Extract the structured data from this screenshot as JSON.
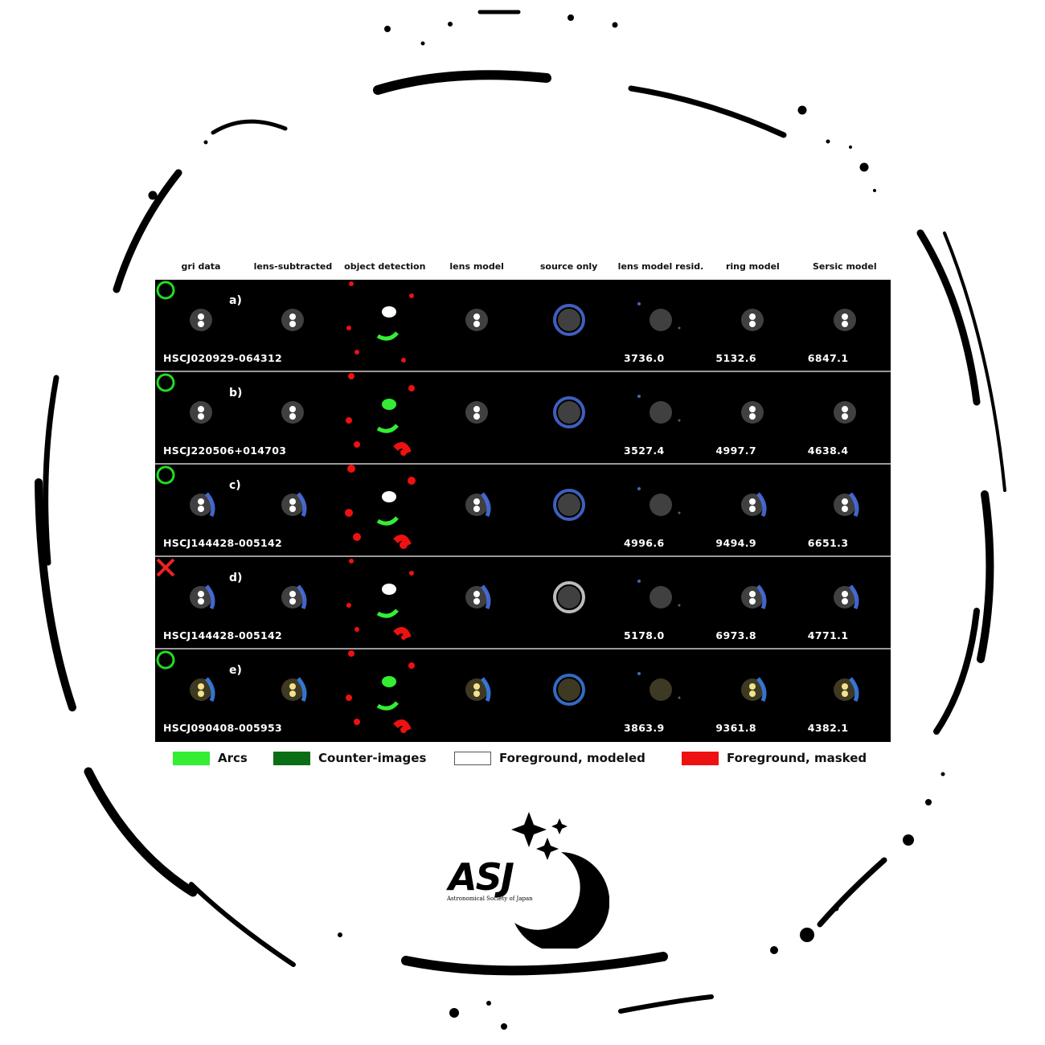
{
  "columns": [
    "gri data",
    "lens-subtracted",
    "object detection",
    "lens model",
    "source only",
    "lens model resid.",
    "ring model",
    "Sersic model"
  ],
  "rows": [
    {
      "label": "a)",
      "id": "HSCJ020929-064312",
      "mark": "circle",
      "scores": [
        "3736.0",
        "5132.6",
        "6847.1"
      ],
      "tint": "blue"
    },
    {
      "label": "b)",
      "id": "HSCJ220506+014703",
      "mark": "circle",
      "scores": [
        "3527.4",
        "4997.7",
        "4638.4"
      ],
      "tint": "blue"
    },
    {
      "label": "c)",
      "id": "HSCJ144428-005142",
      "mark": "circle",
      "scores": [
        "4996.6",
        "9494.9",
        "6651.3"
      ],
      "tint": "blue"
    },
    {
      "label": "d)",
      "id": "HSCJ144428-005142",
      "mark": "cross",
      "scores": [
        "5178.0",
        "6973.8",
        "4771.1"
      ],
      "tint": "blue"
    },
    {
      "label": "e)",
      "id": "HSCJ090408-005953",
      "mark": "circle",
      "scores": [
        "3863.9",
        "9361.8",
        "4382.1"
      ],
      "tint": "yellow"
    }
  ],
  "legend": [
    {
      "label": "Arcs",
      "color": "#33ee33",
      "outline": false
    },
    {
      "label": "Counter-images",
      "color": "#0a6e14",
      "outline": false
    },
    {
      "label": "Foreground, modeled",
      "color": "#ffffff",
      "outline": true
    },
    {
      "label": "Foreground, masked",
      "color": "#ee1111",
      "outline": false
    }
  ],
  "logo": {
    "text": "ASJ",
    "subtitle": "Astronomical Society of Japan"
  },
  "colors": {
    "accept": "#22dd22",
    "reject": "#ee2222",
    "arc": "#4a6fe0",
    "core": "#ffffff"
  }
}
